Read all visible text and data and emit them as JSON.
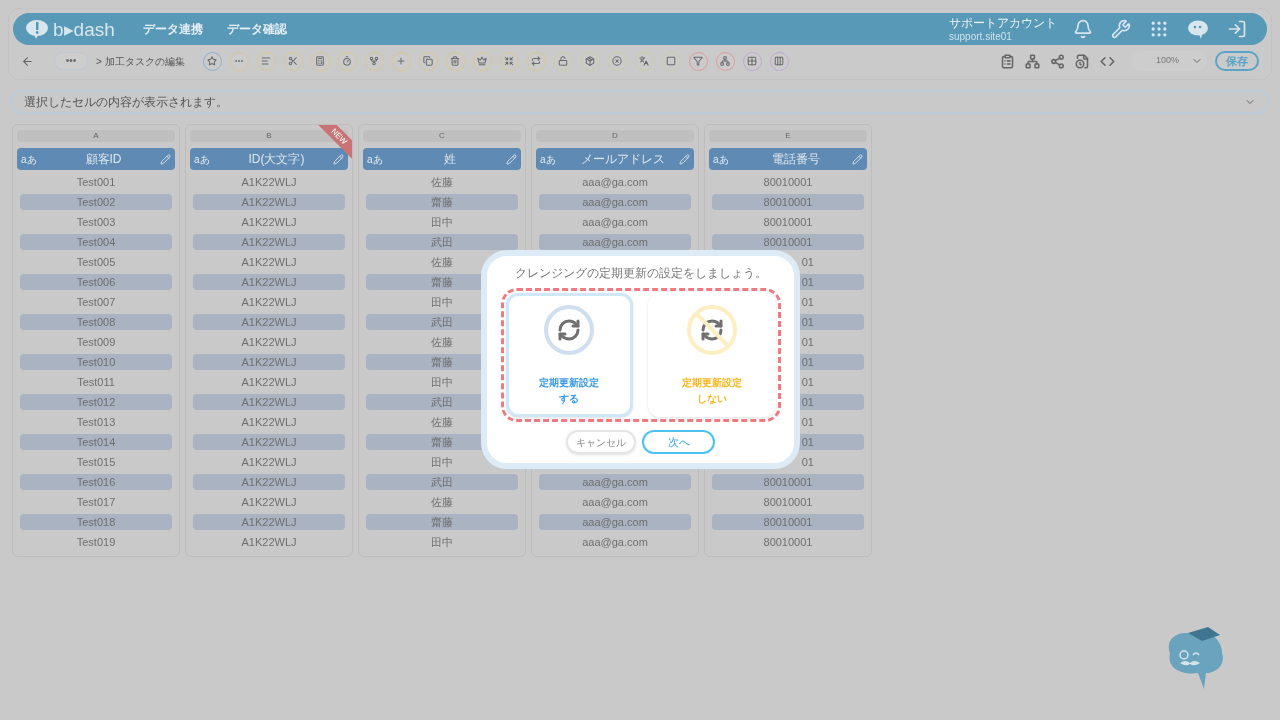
{
  "header": {
    "logo": "b▸dash",
    "nav": [
      "データ連携",
      "データ確認"
    ],
    "account": {
      "label": "サポートアカウント",
      "id": "support.site01"
    }
  },
  "toolbar": {
    "more": "•••",
    "breadcrumb": "> 加工タスクの編集",
    "zoom": "100%",
    "save": "保存"
  },
  "cell_bar": {
    "placeholder": "選択したセルの内容が表示されます。"
  },
  "columns": [
    {
      "letter": "A",
      "title": "顧客ID",
      "type": "aあ",
      "new": false,
      "cells": [
        "Test001",
        "Test002",
        "Test003",
        "Test004",
        "Test005",
        "Test006",
        "Test007",
        "Test008",
        "Test009",
        "Test010",
        "Test011",
        "Test012",
        "Test013",
        "Test014",
        "Test015",
        "Test016",
        "Test017",
        "Test018",
        "Test019"
      ]
    },
    {
      "letter": "B",
      "title": "ID(大文字)",
      "type": "aあ",
      "new": true,
      "badge": "NEW",
      "cells": [
        "A1K22WLJ",
        "A1K22WLJ",
        "A1K22WLJ",
        "A1K22WLJ",
        "A1K22WLJ",
        "A1K22WLJ",
        "A1K22WLJ",
        "A1K22WLJ",
        "A1K22WLJ",
        "A1K22WLJ",
        "A1K22WLJ",
        "A1K22WLJ",
        "A1K22WLJ",
        "A1K22WLJ",
        "A1K22WLJ",
        "A1K22WLJ",
        "A1K22WLJ",
        "A1K22WLJ",
        "A1K22WLJ"
      ]
    },
    {
      "letter": "C",
      "title": "姓",
      "type": "aあ",
      "new": false,
      "cells": [
        "佐藤",
        "齋藤",
        "田中",
        "武田",
        "佐藤",
        "齋藤",
        "田中",
        "武田",
        "佐藤",
        "齋藤",
        "田中",
        "武田",
        "佐藤",
        "齋藤",
        "田中",
        "武田",
        "佐藤",
        "齋藤",
        "田中"
      ]
    },
    {
      "letter": "D",
      "title": "メールアドレス",
      "type": "aあ",
      "new": false,
      "cells": [
        "aaa@ga.com",
        "aaa@ga.com",
        "aaa@ga.com",
        "aaa@ga.com",
        null,
        null,
        null,
        null,
        null,
        null,
        null,
        null,
        null,
        null,
        null,
        "aaa@ga.com",
        "aaa@ga.com",
        "aaa@ga.com",
        "aaa@ga.com"
      ]
    },
    {
      "letter": "E",
      "title": "電話番号",
      "type": "aあ",
      "new": false,
      "cells": [
        "80010001",
        "80010001",
        "80010001",
        "80010001",
        {
          "text": "01",
          "clipped": true
        },
        {
          "text": "01",
          "clipped": true
        },
        {
          "text": "01",
          "clipped": true
        },
        {
          "text": "01",
          "clipped": true
        },
        {
          "text": "01",
          "clipped": true
        },
        {
          "text": "01",
          "clipped": true
        },
        {
          "text": "01",
          "clipped": true
        },
        {
          "text": "01",
          "clipped": true
        },
        {
          "text": "01",
          "clipped": true
        },
        {
          "text": "01",
          "clipped": true
        },
        {
          "text": "01",
          "clipped": true
        },
        "80010001",
        "80010001",
        "80010001",
        "80010001"
      ]
    }
  ],
  "dialog": {
    "title": "クレンジングの定期更新の設定をしましょう。",
    "options": [
      {
        "kind": "on",
        "lines": [
          "定期更新設定",
          "する"
        ],
        "selected": true
      },
      {
        "kind": "off",
        "lines": [
          "定期更新設定",
          "しない"
        ],
        "selected": false
      }
    ],
    "cancel": "キャンセル",
    "next": "次へ"
  }
}
